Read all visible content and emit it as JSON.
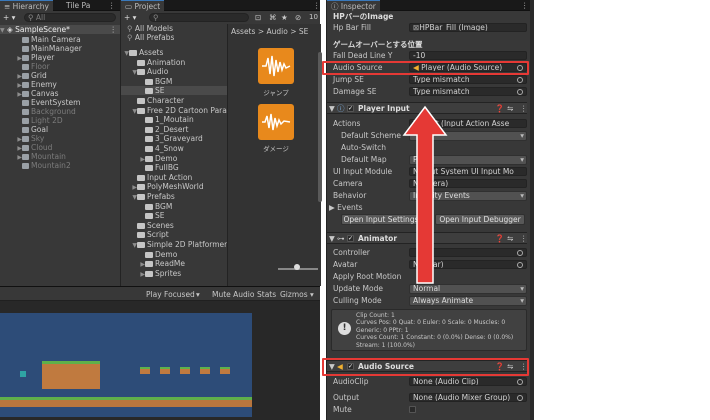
{
  "hierarchy": {
    "tab": "Hierarchy",
    "tab2": "Tile Pa",
    "add": "+ ▾",
    "search": "All",
    "scene": "SampleScene*",
    "items": [
      {
        "label": "Main Camera",
        "dim": false,
        "arrow": ""
      },
      {
        "label": "MainManager",
        "dim": false,
        "arrow": ""
      },
      {
        "label": "Player",
        "dim": false,
        "arrow": "▶"
      },
      {
        "label": "Floor",
        "dim": true,
        "arrow": ""
      },
      {
        "label": "Grid",
        "dim": false,
        "arrow": "▶"
      },
      {
        "label": "Enemy",
        "dim": false,
        "arrow": "▶"
      },
      {
        "label": "Canvas",
        "dim": false,
        "arrow": "▶"
      },
      {
        "label": "EventSystem",
        "dim": false,
        "arrow": ""
      },
      {
        "label": "Background",
        "dim": true,
        "arrow": ""
      },
      {
        "label": "Light 2D",
        "dim": true,
        "arrow": ""
      },
      {
        "label": "Goal",
        "dim": false,
        "arrow": ""
      },
      {
        "label": "Sky",
        "dim": true,
        "arrow": "▶"
      },
      {
        "label": "Cloud",
        "dim": true,
        "arrow": "▶"
      },
      {
        "label": "Mountain",
        "dim": true,
        "arrow": "▶"
      },
      {
        "label": "Mountain2",
        "dim": true,
        "arrow": ""
      }
    ]
  },
  "project": {
    "tab": "Project",
    "add": "+ ▾",
    "badge": "10",
    "favorites": [
      "All Models",
      "All Prefabs"
    ],
    "breadcrumb": [
      "Assets",
      ">",
      "Audio",
      ">",
      "SE"
    ],
    "tree": [
      {
        "label": "Assets",
        "indent": 0,
        "arrow": "▼"
      },
      {
        "label": "Animation",
        "indent": 1,
        "arrow": ""
      },
      {
        "label": "Audio",
        "indent": 1,
        "arrow": "▼"
      },
      {
        "label": "BGM",
        "indent": 2,
        "arrow": ""
      },
      {
        "label": "SE",
        "indent": 2,
        "arrow": "",
        "selected": true
      },
      {
        "label": "Character",
        "indent": 1,
        "arrow": ""
      },
      {
        "label": "Free 2D Cartoon Para",
        "indent": 1,
        "arrow": "▼"
      },
      {
        "label": "1_Moutain",
        "indent": 2,
        "arrow": ""
      },
      {
        "label": "2_Desert",
        "indent": 2,
        "arrow": ""
      },
      {
        "label": "3_Graveyard",
        "indent": 2,
        "arrow": ""
      },
      {
        "label": "4_Snow",
        "indent": 2,
        "arrow": ""
      },
      {
        "label": "Demo",
        "indent": 2,
        "arrow": "▶"
      },
      {
        "label": "FullBG",
        "indent": 2,
        "arrow": ""
      },
      {
        "label": "Input Action",
        "indent": 1,
        "arrow": ""
      },
      {
        "label": "PolyMeshWorld",
        "indent": 1,
        "arrow": "▶"
      },
      {
        "label": "Prefabs",
        "indent": 1,
        "arrow": "▼"
      },
      {
        "label": "BGM",
        "indent": 2,
        "arrow": ""
      },
      {
        "label": "SE",
        "indent": 2,
        "arrow": ""
      },
      {
        "label": "Scenes",
        "indent": 1,
        "arrow": ""
      },
      {
        "label": "Script",
        "indent": 1,
        "arrow": ""
      },
      {
        "label": "Simple 2D Platformer",
        "indent": 1,
        "arrow": "▼"
      },
      {
        "label": "Demo",
        "indent": 2,
        "arrow": ""
      },
      {
        "label": "ReadMe",
        "indent": 2,
        "arrow": "▶"
      },
      {
        "label": "Sprites",
        "indent": 2,
        "arrow": "▶"
      }
    ],
    "assets": [
      {
        "label": "ジャンプ"
      },
      {
        "label": "ダメージ"
      }
    ]
  },
  "game": {
    "play_focused": "Play Focused",
    "mute": "Mute Audio",
    "stats": "Stats",
    "gizmos": "Gizmos"
  },
  "inspector": {
    "tab": "Inspector",
    "top_header": "HPバーのImage",
    "hp_label": "Hp Bar Fill",
    "hp_value": "HPBar_Fill (Image)",
    "section_title": "ゲームオーバーとする位置",
    "fall_label": "Fall Dead Line Y",
    "fall_value": "-10",
    "audio_label": "Audio Source",
    "audio_value": "Player (Audio Source)",
    "jump_label": "Jump SE",
    "jump_value": "Type mismatch",
    "damage_label": "Damage SE",
    "damage_value": "Type mismatch",
    "player_input": {
      "title": "Player Input",
      "actions_label": "Actions",
      "actions_value": "Project (Input Action Asse",
      "default_scheme": "Default Scheme",
      "auto_switch": "Auto-Switch",
      "default_map": "Default Map",
      "default_map_value": "Pl",
      "ui_module": "UI Input Module",
      "ui_module_value": "N   nput System UI Input Mo",
      "camera": "Camera",
      "camera_value": "N   amera)",
      "behavior": "Behavior",
      "behavior_value": "In    Unity Events",
      "events": "Events",
      "open_settings": "Open Input Settings",
      "open_debugger": "Open Input Debugger"
    },
    "animator": {
      "title": "Animator",
      "controller": "Controller",
      "controller_value": "",
      "avatar": "Avatar",
      "avatar_value": "N    vatar)",
      "root_motion": "Apply Root Motion",
      "update_mode": "Update Mode",
      "update_value": "Normal",
      "culling": "Culling Mode",
      "culling_value": "Always Animate",
      "info": [
        "Clip Count: 1",
        "Curves Pos: 0 Quat: 0 Euler: 0 Scale: 0 Muscles: 0",
        "Generic: 0 PPtr: 1",
        "Curves Count: 1 Constant: 0 (0.0%) Dense: 0 (0.0%)",
        "Stream: 1 (100.0%)"
      ]
    },
    "audio_source": {
      "title": "Audio Source",
      "clip": "AudioClip",
      "clip_value": "None (Audio Clip)",
      "output": "Output",
      "output_value": "None (Audio Mixer Group)",
      "mute": "Mute"
    }
  },
  "colors": {
    "accent": "#3a79bb",
    "red_highlight": "#e53935",
    "arrow_red": "#e53935",
    "game_sky": "#2d4c78"
  }
}
